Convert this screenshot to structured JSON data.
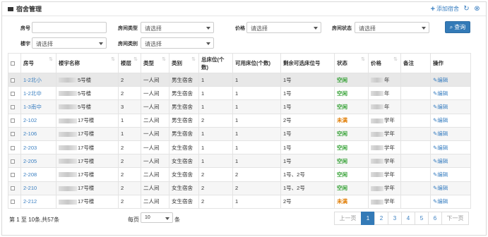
{
  "header": {
    "title": "宿舍管理",
    "add_label": "添加宿舍",
    "icons": [
      "home-icon",
      "plus-icon",
      "refresh-icon",
      "close-circle-icon"
    ]
  },
  "filters": {
    "room_no_label": "房号",
    "room_type_label": "房间类型",
    "room_type_value": "请选择",
    "price_label": "价格",
    "price_value": "请选择",
    "room_status_label": "房间状态",
    "room_status_value": "请选择",
    "building_label": "楼宇",
    "building_value": "请选择",
    "room_category_label": "房间类别",
    "room_category_value": "请选择",
    "query_label": "查询"
  },
  "table": {
    "columns": [
      "房号",
      "楼宇名称",
      "楼层",
      "类型",
      "类别",
      "总床位(个数)",
      "可用床位(个数)",
      "剩余可选床位号",
      "状态",
      "价格",
      "备注",
      "操作"
    ],
    "rows": [
      {
        "room": "1-2北小",
        "building": "5号楼",
        "floor": "2",
        "type": "一人间",
        "category": "男生宿舍",
        "total": "1",
        "avail": "1",
        "beds": "1号",
        "status": "空闲",
        "price": "年"
      },
      {
        "room": "1-2北中",
        "building": "5号楼",
        "floor": "2",
        "type": "一人间",
        "category": "男生宿舍",
        "total": "1",
        "avail": "1",
        "beds": "1号",
        "status": "空闲",
        "price": "年"
      },
      {
        "room": "1-3南中",
        "building": "5号楼",
        "floor": "3",
        "type": "一人间",
        "category": "男生宿舍",
        "total": "1",
        "avail": "1",
        "beds": "1号",
        "status": "空闲",
        "price": "年"
      },
      {
        "room": "2-102",
        "building": "17号楼",
        "floor": "1",
        "type": "二人间",
        "category": "男生宿舍",
        "total": "2",
        "avail": "1",
        "beds": "2号",
        "status": "未满",
        "price": "学年"
      },
      {
        "room": "2-106",
        "building": "17号楼",
        "floor": "1",
        "type": "一人间",
        "category": "男生宿舍",
        "total": "1",
        "avail": "1",
        "beds": "1号",
        "status": "空闲",
        "price": "学年"
      },
      {
        "room": "2-203",
        "building": "17号楼",
        "floor": "2",
        "type": "一人间",
        "category": "女生宿舍",
        "total": "1",
        "avail": "1",
        "beds": "1号",
        "status": "空闲",
        "price": "学年"
      },
      {
        "room": "2-205",
        "building": "17号楼",
        "floor": "2",
        "type": "一人间",
        "category": "女生宿舍",
        "total": "1",
        "avail": "1",
        "beds": "1号",
        "status": "空闲",
        "price": "学年"
      },
      {
        "room": "2-208",
        "building": "17号楼",
        "floor": "2",
        "type": "二人间",
        "category": "女生宿舍",
        "total": "2",
        "avail": "2",
        "beds": "1号、2号",
        "status": "空闲",
        "price": "学年"
      },
      {
        "room": "2-210",
        "building": "17号楼",
        "floor": "2",
        "type": "二人间",
        "category": "女生宿舍",
        "total": "2",
        "avail": "2",
        "beds": "1号、2号",
        "status": "空闲",
        "price": "学年"
      },
      {
        "room": "2-212",
        "building": "17号楼",
        "floor": "2",
        "type": "二人间",
        "category": "女生宿舍",
        "total": "2",
        "avail": "1",
        "beds": "2号",
        "status": "未满",
        "price": "学年"
      }
    ],
    "edit_label": "编辑"
  },
  "footer": {
    "info": "第 1 至 10条,共57条",
    "per_page_label": "每页",
    "per_page_value": "10",
    "per_page_unit": "条",
    "prev_label": "上一页",
    "next_label": "下一页",
    "pages": [
      "1",
      "2",
      "3",
      "4",
      "5",
      "6"
    ],
    "current_page": "1"
  },
  "colors": {
    "accent": "#337ab7",
    "link": "#3a7fc1",
    "status_free": "#2e9e2e",
    "status_not_full": "#e07b00"
  }
}
